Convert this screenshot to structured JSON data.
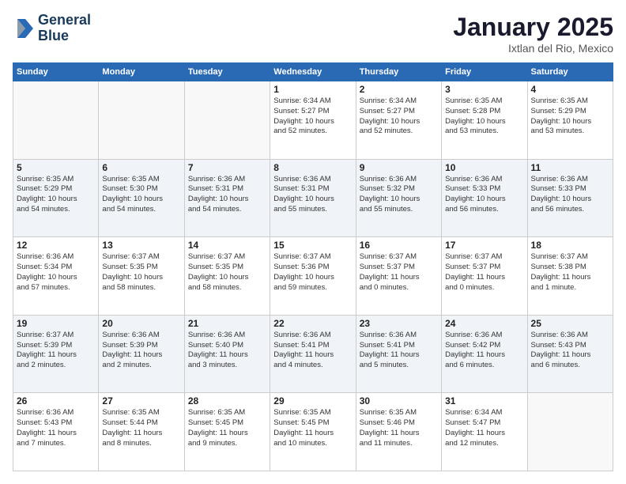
{
  "header": {
    "logo_line1": "General",
    "logo_line2": "Blue",
    "month": "January 2025",
    "location": "Ixtlan del Rio, Mexico"
  },
  "weekdays": [
    "Sunday",
    "Monday",
    "Tuesday",
    "Wednesday",
    "Thursday",
    "Friday",
    "Saturday"
  ],
  "weeks": [
    [
      {
        "day": "",
        "info": ""
      },
      {
        "day": "",
        "info": ""
      },
      {
        "day": "",
        "info": ""
      },
      {
        "day": "1",
        "info": "Sunrise: 6:34 AM\nSunset: 5:27 PM\nDaylight: 10 hours\nand 52 minutes."
      },
      {
        "day": "2",
        "info": "Sunrise: 6:34 AM\nSunset: 5:27 PM\nDaylight: 10 hours\nand 52 minutes."
      },
      {
        "day": "3",
        "info": "Sunrise: 6:35 AM\nSunset: 5:28 PM\nDaylight: 10 hours\nand 53 minutes."
      },
      {
        "day": "4",
        "info": "Sunrise: 6:35 AM\nSunset: 5:29 PM\nDaylight: 10 hours\nand 53 minutes."
      }
    ],
    [
      {
        "day": "5",
        "info": "Sunrise: 6:35 AM\nSunset: 5:29 PM\nDaylight: 10 hours\nand 54 minutes."
      },
      {
        "day": "6",
        "info": "Sunrise: 6:35 AM\nSunset: 5:30 PM\nDaylight: 10 hours\nand 54 minutes."
      },
      {
        "day": "7",
        "info": "Sunrise: 6:36 AM\nSunset: 5:31 PM\nDaylight: 10 hours\nand 54 minutes."
      },
      {
        "day": "8",
        "info": "Sunrise: 6:36 AM\nSunset: 5:31 PM\nDaylight: 10 hours\nand 55 minutes."
      },
      {
        "day": "9",
        "info": "Sunrise: 6:36 AM\nSunset: 5:32 PM\nDaylight: 10 hours\nand 55 minutes."
      },
      {
        "day": "10",
        "info": "Sunrise: 6:36 AM\nSunset: 5:33 PM\nDaylight: 10 hours\nand 56 minutes."
      },
      {
        "day": "11",
        "info": "Sunrise: 6:36 AM\nSunset: 5:33 PM\nDaylight: 10 hours\nand 56 minutes."
      }
    ],
    [
      {
        "day": "12",
        "info": "Sunrise: 6:36 AM\nSunset: 5:34 PM\nDaylight: 10 hours\nand 57 minutes."
      },
      {
        "day": "13",
        "info": "Sunrise: 6:37 AM\nSunset: 5:35 PM\nDaylight: 10 hours\nand 58 minutes."
      },
      {
        "day": "14",
        "info": "Sunrise: 6:37 AM\nSunset: 5:35 PM\nDaylight: 10 hours\nand 58 minutes."
      },
      {
        "day": "15",
        "info": "Sunrise: 6:37 AM\nSunset: 5:36 PM\nDaylight: 10 hours\nand 59 minutes."
      },
      {
        "day": "16",
        "info": "Sunrise: 6:37 AM\nSunset: 5:37 PM\nDaylight: 11 hours\nand 0 minutes."
      },
      {
        "day": "17",
        "info": "Sunrise: 6:37 AM\nSunset: 5:37 PM\nDaylight: 11 hours\nand 0 minutes."
      },
      {
        "day": "18",
        "info": "Sunrise: 6:37 AM\nSunset: 5:38 PM\nDaylight: 11 hours\nand 1 minute."
      }
    ],
    [
      {
        "day": "19",
        "info": "Sunrise: 6:37 AM\nSunset: 5:39 PM\nDaylight: 11 hours\nand 2 minutes."
      },
      {
        "day": "20",
        "info": "Sunrise: 6:36 AM\nSunset: 5:39 PM\nDaylight: 11 hours\nand 2 minutes."
      },
      {
        "day": "21",
        "info": "Sunrise: 6:36 AM\nSunset: 5:40 PM\nDaylight: 11 hours\nand 3 minutes."
      },
      {
        "day": "22",
        "info": "Sunrise: 6:36 AM\nSunset: 5:41 PM\nDaylight: 11 hours\nand 4 minutes."
      },
      {
        "day": "23",
        "info": "Sunrise: 6:36 AM\nSunset: 5:41 PM\nDaylight: 11 hours\nand 5 minutes."
      },
      {
        "day": "24",
        "info": "Sunrise: 6:36 AM\nSunset: 5:42 PM\nDaylight: 11 hours\nand 6 minutes."
      },
      {
        "day": "25",
        "info": "Sunrise: 6:36 AM\nSunset: 5:43 PM\nDaylight: 11 hours\nand 6 minutes."
      }
    ],
    [
      {
        "day": "26",
        "info": "Sunrise: 6:36 AM\nSunset: 5:43 PM\nDaylight: 11 hours\nand 7 minutes."
      },
      {
        "day": "27",
        "info": "Sunrise: 6:35 AM\nSunset: 5:44 PM\nDaylight: 11 hours\nand 8 minutes."
      },
      {
        "day": "28",
        "info": "Sunrise: 6:35 AM\nSunset: 5:45 PM\nDaylight: 11 hours\nand 9 minutes."
      },
      {
        "day": "29",
        "info": "Sunrise: 6:35 AM\nSunset: 5:45 PM\nDaylight: 11 hours\nand 10 minutes."
      },
      {
        "day": "30",
        "info": "Sunrise: 6:35 AM\nSunset: 5:46 PM\nDaylight: 11 hours\nand 11 minutes."
      },
      {
        "day": "31",
        "info": "Sunrise: 6:34 AM\nSunset: 5:47 PM\nDaylight: 11 hours\nand 12 minutes."
      },
      {
        "day": "",
        "info": ""
      }
    ]
  ]
}
